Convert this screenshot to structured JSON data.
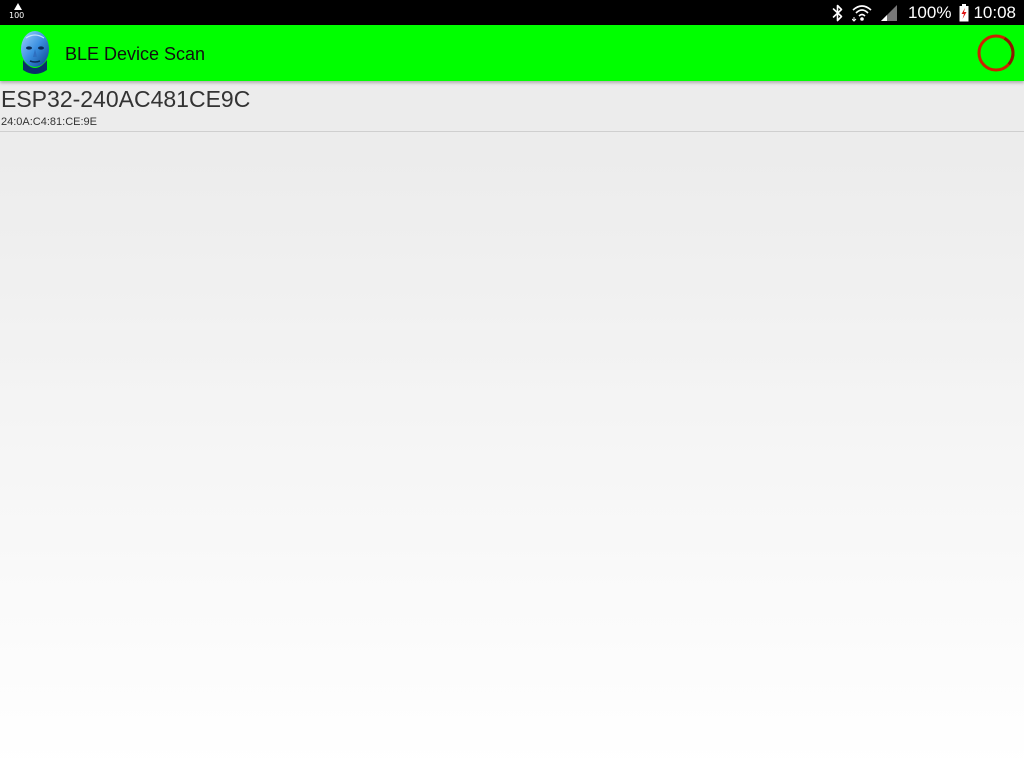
{
  "status_bar": {
    "notification_text": "100",
    "icons": [
      "upload-arrow-icon",
      "bluetooth-icon",
      "wifi-icon",
      "cell-signal-icon",
      "battery-charging-icon"
    ],
    "battery_percent": "100%",
    "time": "10:08"
  },
  "action_bar": {
    "title": "BLE Device Scan",
    "background_color": "#00ff00",
    "scan_indicator_icon": "progress-ring-icon",
    "scan_indicator_color": "#cc2200"
  },
  "devices": [
    {
      "name": "ESP32-240AC481CE9C",
      "address": "24:0A:C4:81:CE:9E"
    }
  ]
}
